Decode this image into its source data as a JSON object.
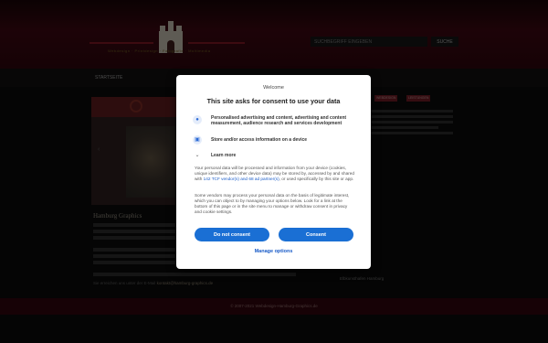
{
  "site": {
    "logo_subtitle": "Webdesign · Printdesign · Fotografie · Multimedia",
    "search_placeholder": "SUCHBEGRIFF EINGEBEN",
    "search_button": "SUCHE",
    "nav": [
      "STARTSEITE"
    ],
    "section_title": "Hamburg Graphics",
    "contact_prefix": "Sie erreichen uns unter der E-Mail",
    "contact_email": "kontakt@hamburg-graphics.de",
    "side_tags": [
      "WEBDESIGN",
      "LEISTUNGEN"
    ],
    "side_caption": "Elbkunsthafen Hamburg",
    "footer": "© 2007-2021 Webdesign-Hamburg-Graphics.de"
  },
  "dialog": {
    "welcome": "Welcome",
    "title": "This site asks for consent to use your data",
    "purposes": [
      {
        "icon": "person-icon",
        "label": "Personalised advertising and content, advertising and content measurement, audience research and services development"
      },
      {
        "icon": "device-icon",
        "label": "Store and/or access information on a device"
      }
    ],
    "learn_more": "Learn more",
    "para1_a": "Your personal data will be processed and information from your device (cookies, unique identifiers, and other device data) may be stored by, accessed by and shared with",
    "para1_link": "142 TCF vendor(s) and 68 ad partner(s)",
    "para1_b": ", or used specifically by this site or app.",
    "para2": "Some vendors may process your personal data on the basis of legitimate interest, which you can object to by managing your options below. Look for a link at the bottom of this page or in the site menu to manage or withdraw consent in privacy and cookie settings.",
    "do_not_consent": "Do not consent",
    "consent": "Consent",
    "manage_options": "Manage options"
  }
}
